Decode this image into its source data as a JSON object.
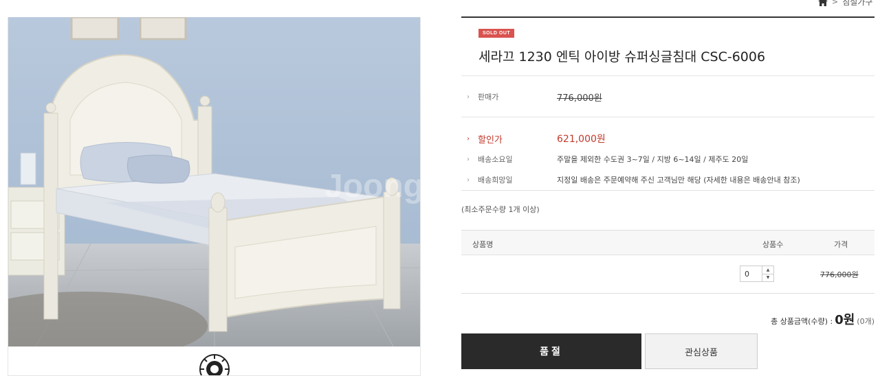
{
  "breadcrumb": {
    "current": "침실가구"
  },
  "product": {
    "badge": "SOLD OUT",
    "title": "세라끄 1230 엔틱 아이방 슈퍼싱글침대 CSC-6006",
    "watermark": "Joong"
  },
  "info": {
    "price_label": "판매가",
    "price_value": "776,000원",
    "sale_label": "할인가",
    "sale_value": "621,000원",
    "ship_label": "배송소요일",
    "ship_value": "주말을 제외한 수도권 3~7일 / 지방 6~14일 / 제주도 20일",
    "hope_label": "배송희망일",
    "hope_value": "지정일 배송은 주문예약해 주신 고객님만 해당 (자세한 내용은 배송안내 참조)"
  },
  "min_order": "(최소주문수량 1개 이상)",
  "options_table": {
    "headers": [
      "상품명",
      "상품수",
      "가격"
    ],
    "rows": [
      {
        "name": "",
        "quantity": "0",
        "price": "776,000원"
      }
    ]
  },
  "total": {
    "label": "총 상품금액(수량) :",
    "amount": "0원",
    "count": "(0개)"
  },
  "buttons": {
    "soldout": "품절",
    "wishlist": "관심상품"
  },
  "colors": {
    "accent_red": "#c0392b",
    "badge": "#d9534f",
    "button_dark": "#2a2a2a"
  }
}
